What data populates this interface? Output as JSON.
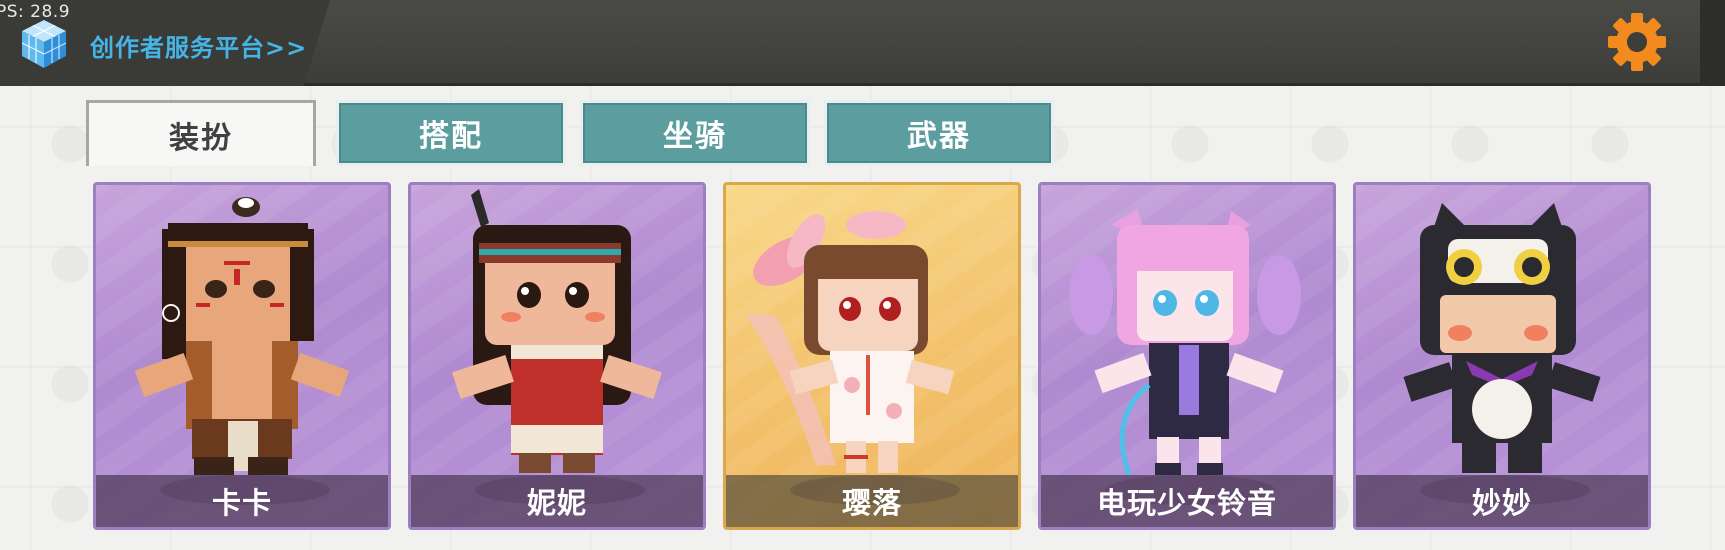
{
  "fps_text": "PS: 28.9",
  "header": {
    "creator_link": "创作者服务平台>>",
    "settings_icon": "gear-icon"
  },
  "tabs": [
    {
      "label": "装扮",
      "active": true
    },
    {
      "label": "搭配",
      "active": false
    },
    {
      "label": "坐骑",
      "active": false
    },
    {
      "label": "武器",
      "active": false
    }
  ],
  "skins": [
    {
      "name": "卡卡",
      "frame": "purple"
    },
    {
      "name": "妮妮",
      "frame": "purple"
    },
    {
      "name": "璎落",
      "frame": "gold"
    },
    {
      "name": "电玩少女铃音",
      "frame": "purple"
    },
    {
      "name": "妙妙",
      "frame": "purple"
    }
  ],
  "colors": {
    "accent_orange": "#f28a1e",
    "link_blue": "#45b4e6",
    "tab_teal": "#5c9ea0",
    "card_purple": "#b08ad0",
    "card_gold": "#f3c36d"
  }
}
